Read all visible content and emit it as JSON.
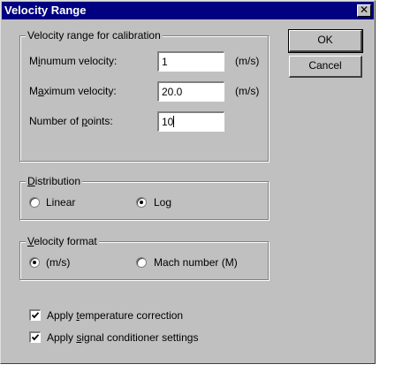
{
  "window": {
    "title": "Velocity Range",
    "close_glyph": "✕"
  },
  "calibration": {
    "group_label": "Velocity range for calibration",
    "min_label_pre": "M",
    "min_label_key": "i",
    "min_label_post": "numum velocity:",
    "min_value": "1",
    "min_unit": "(m/s)",
    "max_label_pre": "M",
    "max_label_key": "a",
    "max_label_post": "ximum velocity:",
    "max_value": "20.0",
    "max_unit": "(m/s)",
    "points_label_pre": "Number of ",
    "points_label_key": "p",
    "points_label_post": "oints:",
    "points_value": "10"
  },
  "distribution": {
    "group_label_key": "D",
    "group_label_post": "istribution",
    "options": [
      "Linear",
      "Log"
    ],
    "selected": "Log"
  },
  "velocity_format": {
    "group_label_key": "V",
    "group_label_post": "elocity format",
    "options": [
      "(m/s)",
      "Mach number (M)"
    ],
    "selected": "(m/s)"
  },
  "checkboxes": {
    "temp_pre": "Apply ",
    "temp_key": "t",
    "temp_post": "emperature correction",
    "temp_checked": true,
    "signal_pre": "Apply ",
    "signal_key": "s",
    "signal_post": "ignal conditioner settings",
    "signal_checked": true
  },
  "buttons": {
    "ok": "OK",
    "cancel": "Cancel"
  },
  "icons": {
    "close": "close-icon",
    "check": "check-icon"
  }
}
